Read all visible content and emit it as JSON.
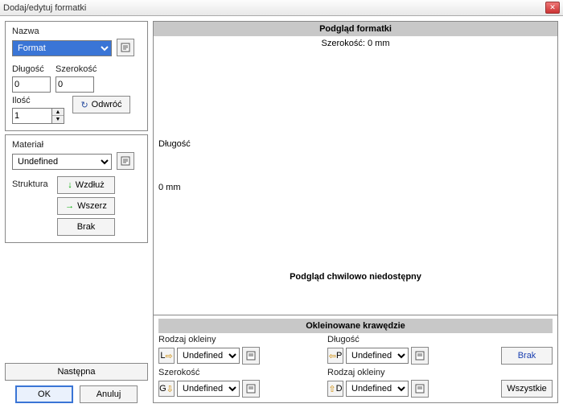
{
  "window": {
    "title": "Dodaj/edytuj formatki"
  },
  "left": {
    "name_label": "Nazwa",
    "name_value": "Format",
    "length_label": "Długość",
    "length_value": "0",
    "width_label": "Szerokość",
    "width_value": "0",
    "swap_label": "Odwróć",
    "qty_label": "Ilość",
    "qty_value": "1",
    "material_label": "Materiał",
    "material_value": "Undefined",
    "structure_label": "Struktura",
    "along_label": "Wzdłuż",
    "across_label": "Wszerz",
    "none_label": "Brak",
    "next_label": "Następna",
    "ok_label": "OK",
    "cancel_label": "Anuluj"
  },
  "preview": {
    "header": "Podgląd formatki",
    "width_text": "Szerokość: 0 mm",
    "length_text": "Długość",
    "zero_text": "0 mm",
    "unavailable": "Podgląd chwilowo niedostępny"
  },
  "edges": {
    "header": "Okleinowane krawędzie",
    "type_label": "Rodzaj okleiny",
    "length_label": "Długość",
    "width_label": "Szerokość",
    "L_letter": "L",
    "P_letter": "P",
    "G_letter": "G",
    "D_letter": "D",
    "undef": "Undefined",
    "none_btn": "Brak",
    "all_btn": "Wszystkie"
  }
}
